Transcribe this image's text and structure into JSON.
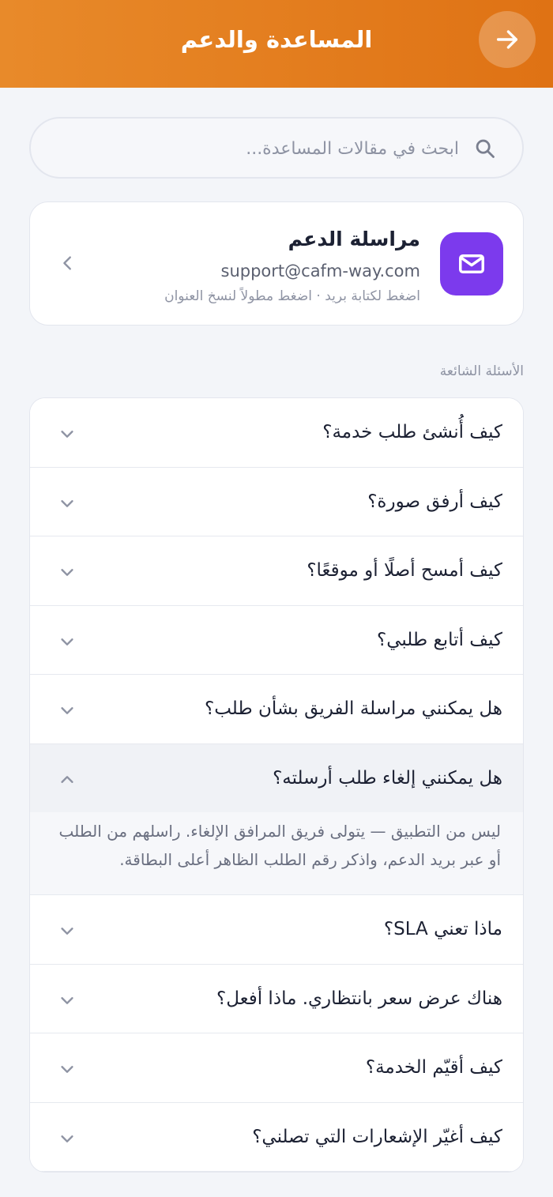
{
  "header": {
    "title": "المساعدة والدعم",
    "back_icon": "arrow-right-icon",
    "accent": "#e47d1f"
  },
  "search": {
    "placeholder": "ابحث في مقالات المساعدة...",
    "value": "",
    "icon": "search-icon"
  },
  "support": {
    "title": "مراسلة الدعم",
    "email": "support@cafm-way.com",
    "hint": "اضغط لكتابة بريد · اضغط مطولاً لنسخ العنوان",
    "icon": "mail-icon",
    "icon_color": "#7c3aed"
  },
  "faq": {
    "section_label": "الأسئلة الشائعة",
    "items": [
      {
        "question": "كيف أُنشئ طلب خدمة؟",
        "open": false
      },
      {
        "question": "كيف أرفق صورة؟",
        "open": false
      },
      {
        "question": "كيف أمسح أصلًا أو موقعًا؟",
        "open": false
      },
      {
        "question": "كيف أتابع طلبي؟",
        "open": false
      },
      {
        "question": "هل يمكنني مراسلة الفريق بشأن طلب؟",
        "open": false
      },
      {
        "question": "هل يمكنني إلغاء طلب أرسلته؟",
        "open": true,
        "answer": "ليس من التطبيق — يتولى فريق المرافق الإلغاء. راسلهم من الطلب أو عبر بريد الدعم، واذكر رقم الطلب الظاهر أعلى البطاقة."
      },
      {
        "question": "ماذا تعني SLA؟",
        "open": false
      },
      {
        "question": "هناك عرض سعر بانتظاري. ماذا أفعل؟",
        "open": false
      },
      {
        "question": "كيف أقيّم الخدمة؟",
        "open": false
      },
      {
        "question": "كيف أغيّر الإشعارات التي تصلني؟",
        "open": false
      }
    ]
  }
}
